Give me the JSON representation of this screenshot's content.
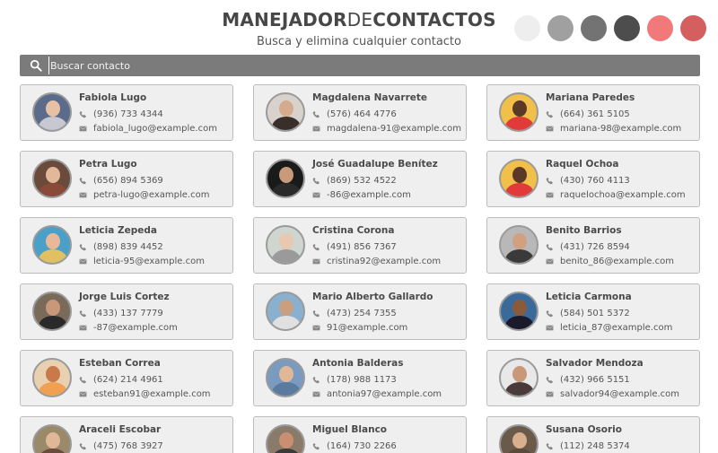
{
  "header": {
    "title_part1": "MANEJADOR",
    "title_part2": "DE",
    "title_part3": "CONTACTOS",
    "subtitle": "Busca y elimina cualquier contacto"
  },
  "theme_swatches": [
    "#eeeeee",
    "#a0a0a0",
    "#737373",
    "#4d4d4d",
    "#f2797a",
    "#d35f5f"
  ],
  "search": {
    "placeholder": "Buscar contacto",
    "value": ""
  },
  "icons": {
    "search": "search-icon",
    "phone": "phone-icon",
    "email": "email-icon"
  },
  "contacts": [
    {
      "name": "Fabiola Lugo",
      "phone": "(936) 733 4344",
      "email": "fabiola_lugo@example.com",
      "avatar_bg": "#5b6b8c",
      "avatar_skin": "#e8c1a5",
      "avatar_shirt": "#c8c8d2"
    },
    {
      "name": "Magdalena Navarrete",
      "phone": "(576) 464 4776",
      "email": "magdalena-91@example.com",
      "avatar_bg": "#d9d2cc",
      "avatar_skin": "#d4ab8e",
      "avatar_shirt": "#3a2e2a"
    },
    {
      "name": "Mariana Paredes",
      "phone": "(664) 361 5105",
      "email": "mariana-98@example.com",
      "avatar_bg": "#f0c04a",
      "avatar_skin": "#5a3a26",
      "avatar_shirt": "#e03a3a"
    },
    {
      "name": "Petra Lugo",
      "phone": "(656) 894 5369",
      "email": "petra-lugo@example.com",
      "avatar_bg": "#6a4a3a",
      "avatar_skin": "#e2b89a",
      "avatar_shirt": "#8a4a3a"
    },
    {
      "name": "José Guadalupe Benítez",
      "phone": "(869) 532 4522",
      "email": "-86@example.com",
      "avatar_bg": "#1a1a1a",
      "avatar_skin": "#c89a7a",
      "avatar_shirt": "#2a2a2a"
    },
    {
      "name": "Raquel Ochoa",
      "phone": "(430) 760 4113",
      "email": "raquelochoa@example.com",
      "avatar_bg": "#f0c04a",
      "avatar_skin": "#5a3a26",
      "avatar_shirt": "#e03a3a"
    },
    {
      "name": "Leticia Zepeda",
      "phone": "(898) 839 4452",
      "email": "leticia-95@example.com",
      "avatar_bg": "#4aa0c8",
      "avatar_skin": "#e8b898",
      "avatar_shirt": "#e0c060"
    },
    {
      "name": "Cristina Corona",
      "phone": "(491) 856 7367",
      "email": "cristina92@example.com",
      "avatar_bg": "#cfd6d0",
      "avatar_skin": "#e8c8b0",
      "avatar_shirt": "#9a9a9a"
    },
    {
      "name": "Benito Barrios",
      "phone": "(431) 726 8594",
      "email": "benito_86@example.com",
      "avatar_bg": "#b8b8b8",
      "avatar_skin": "#d0a080",
      "avatar_shirt": "#3a3a3a"
    },
    {
      "name": "Jorge Luis Cortez",
      "phone": "(433) 137 7779",
      "email": "-87@example.com",
      "avatar_bg": "#7a6a5a",
      "avatar_skin": "#c89878",
      "avatar_shirt": "#2a2a2a"
    },
    {
      "name": "Mario Alberto Gallardo",
      "phone": "(473) 254 7355",
      "email": "91@example.com",
      "avatar_bg": "#8ab0d0",
      "avatar_skin": "#c8a080",
      "avatar_shirt": "#e0e0e0"
    },
    {
      "name": "Leticia Carmona",
      "phone": "(584) 501 5372",
      "email": "leticia_87@example.com",
      "avatar_bg": "#3a6a9a",
      "avatar_skin": "#8a5a3a",
      "avatar_shirt": "#1a1a2a"
    },
    {
      "name": "Esteban Correa",
      "phone": "(624) 214 4961",
      "email": "esteban91@example.com",
      "avatar_bg": "#e8d0b0",
      "avatar_skin": "#c87a4a",
      "avatar_shirt": "#f0a050"
    },
    {
      "name": "Antonia Balderas",
      "phone": "(178) 988 1173",
      "email": "antonia97@example.com",
      "avatar_bg": "#7a9ac0",
      "avatar_skin": "#e0b898",
      "avatar_shirt": "#5a7aa0"
    },
    {
      "name": "Salvador Mendoza",
      "phone": "(432) 966 5151",
      "email": "salvador94@example.com",
      "avatar_bg": "#e8e8e8",
      "avatar_skin": "#c89878",
      "avatar_shirt": "#4a3a3a"
    },
    {
      "name": "Araceli Escobar",
      "phone": "(475) 768 3927",
      "email": "",
      "avatar_bg": "#9a8a6a",
      "avatar_skin": "#e0b898",
      "avatar_shirt": "#6a4a3a"
    },
    {
      "name": "Miguel Blanco",
      "phone": "(164) 730 2266",
      "email": "",
      "avatar_bg": "#8a7a6a",
      "avatar_skin": "#c89070",
      "avatar_shirt": "#3a3a3a"
    },
    {
      "name": "Susana Osorio",
      "phone": "(112) 248 5374",
      "email": "",
      "avatar_bg": "#6a5a4a",
      "avatar_skin": "#d8b090",
      "avatar_shirt": "#5a4a3a"
    }
  ]
}
